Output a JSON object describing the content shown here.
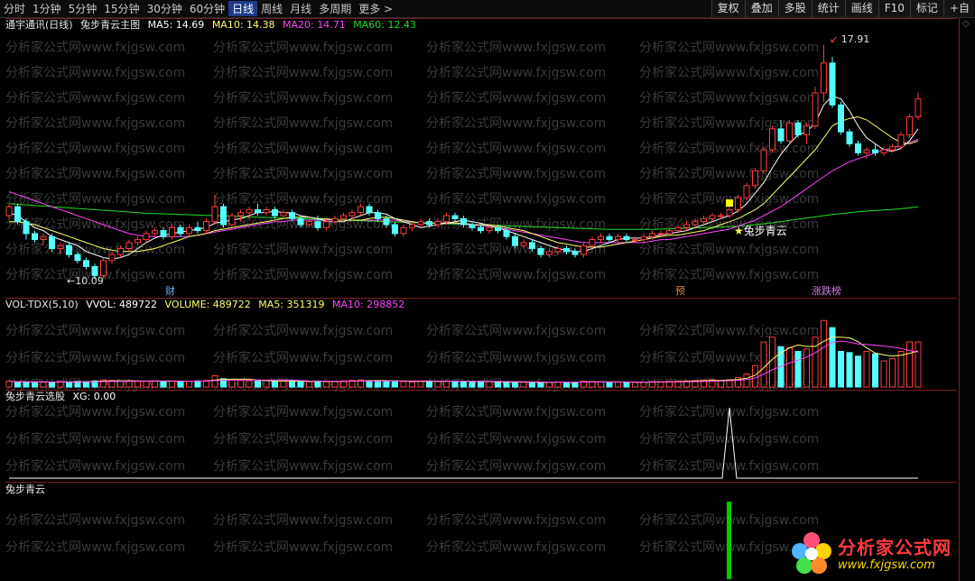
{
  "toolbar": {
    "timeframes": [
      "分时",
      "1分钟",
      "5分钟",
      "15分钟",
      "30分钟",
      "60分钟",
      "日线",
      "周线",
      "月线",
      "多周期",
      "更多 >"
    ],
    "active": "日线",
    "right_buttons": [
      "复权",
      "叠加",
      "多股",
      "统计",
      "画线",
      "F10",
      "标记",
      "+自"
    ]
  },
  "main_panel": {
    "stock": "通宇通讯(日线)",
    "indicator": "兔步青云主图",
    "ma5": "MA5: 14.69",
    "ma10": "MA10: 14.38",
    "ma20": "MA20: 14.71",
    "ma60": "MA60: 12.43",
    "high_label": "17.91",
    "low_label": "10.09",
    "signal_text": "兔步青云",
    "events": [
      "财",
      "预",
      "涨跌榜"
    ]
  },
  "vol_panel": {
    "name": "VOL-TDX(5,10)",
    "vvol": "VVOL: 489722",
    "volume": "VOLUME: 489722",
    "ma5": "MA5: 351319",
    "ma10": "MA10: 298852"
  },
  "xg_panel": {
    "name": "兔步青云选股",
    "xg": "XG: 0.00"
  },
  "signal_panel": {
    "name": "兔步青云"
  },
  "watermark": "分析家公式网www.fxjgsw.com",
  "logo": {
    "title": "分析家公式网",
    "url": "www.fxjgsw.com"
  },
  "colors": {
    "up": "#ff3b3b",
    "down": "#54ffff",
    "ma5": "#ffffff",
    "ma10": "#ffff66",
    "ma20": "#ff44ff",
    "ma60": "#22dd22",
    "signal": "#00cc00"
  },
  "chart_data": {
    "type": "candlestick",
    "price_range": [
      10.09,
      17.91
    ],
    "candles": [
      [
        12.2,
        12.6,
        12.1,
        12.5
      ],
      [
        12.5,
        12.6,
        11.9,
        12.0
      ],
      [
        12.0,
        12.1,
        11.4,
        11.6
      ],
      [
        11.6,
        11.7,
        11.3,
        11.4
      ],
      [
        11.4,
        11.6,
        11.2,
        11.5
      ],
      [
        11.5,
        11.6,
        11.0,
        11.1
      ],
      [
        11.1,
        11.3,
        10.9,
        11.2
      ],
      [
        11.2,
        11.3,
        10.8,
        10.9
      ],
      [
        10.9,
        11.0,
        10.6,
        10.7
      ],
      [
        10.7,
        10.8,
        10.4,
        10.5
      ],
      [
        10.5,
        10.6,
        10.09,
        10.2
      ],
      [
        10.2,
        10.8,
        10.1,
        10.7
      ],
      [
        10.7,
        11.0,
        10.6,
        10.9
      ],
      [
        10.9,
        11.2,
        10.8,
        11.1
      ],
      [
        11.1,
        11.4,
        11.0,
        11.3
      ],
      [
        11.3,
        11.5,
        11.2,
        11.4
      ],
      [
        11.4,
        11.7,
        11.3,
        11.6
      ],
      [
        11.6,
        11.8,
        11.5,
        11.7
      ],
      [
        11.7,
        11.8,
        11.4,
        11.5
      ],
      [
        11.5,
        11.9,
        11.4,
        11.8
      ],
      [
        11.8,
        11.9,
        11.5,
        11.6
      ],
      [
        11.6,
        11.9,
        11.5,
        11.8
      ],
      [
        11.8,
        12.0,
        11.6,
        11.7
      ],
      [
        11.7,
        12.1,
        11.6,
        12.0
      ],
      [
        12.0,
        12.9,
        11.9,
        12.5
      ],
      [
        12.5,
        12.6,
        11.8,
        11.9
      ],
      [
        11.9,
        12.3,
        11.8,
        12.2
      ],
      [
        12.2,
        12.4,
        12.0,
        12.3
      ],
      [
        12.3,
        12.5,
        12.1,
        12.4
      ],
      [
        12.4,
        12.6,
        12.2,
        12.3
      ],
      [
        12.3,
        12.5,
        12.2,
        12.4
      ],
      [
        12.4,
        12.5,
        12.1,
        12.2
      ],
      [
        12.2,
        12.4,
        12.1,
        12.3
      ],
      [
        12.3,
        12.4,
        12.0,
        12.1
      ],
      [
        12.1,
        12.2,
        11.8,
        11.9
      ],
      [
        11.9,
        12.1,
        11.8,
        12.0
      ],
      [
        12.0,
        12.2,
        11.7,
        11.8
      ],
      [
        11.8,
        12.1,
        11.7,
        12.0
      ],
      [
        12.0,
        12.2,
        11.9,
        12.1
      ],
      [
        12.1,
        12.3,
        12.0,
        12.2
      ],
      [
        12.2,
        12.4,
        12.1,
        12.3
      ],
      [
        12.3,
        12.6,
        12.2,
        12.5
      ],
      [
        12.5,
        12.6,
        12.2,
        12.3
      ],
      [
        12.3,
        12.4,
        12.0,
        12.1
      ],
      [
        12.1,
        12.2,
        11.8,
        11.9
      ],
      [
        11.9,
        12.0,
        11.5,
        11.6
      ],
      [
        11.6,
        11.9,
        11.5,
        11.8
      ],
      [
        11.8,
        12.0,
        11.7,
        11.9
      ],
      [
        11.9,
        12.1,
        11.8,
        12.0
      ],
      [
        12.0,
        12.1,
        11.8,
        11.9
      ],
      [
        11.9,
        12.1,
        11.8,
        12.0
      ],
      [
        12.0,
        12.3,
        11.9,
        12.2
      ],
      [
        12.2,
        12.3,
        12.0,
        12.1
      ],
      [
        12.1,
        12.2,
        11.8,
        11.9
      ],
      [
        11.9,
        12.0,
        11.7,
        11.8
      ],
      [
        11.8,
        11.9,
        11.6,
        11.7
      ],
      [
        11.7,
        11.9,
        11.6,
        11.8
      ],
      [
        11.8,
        11.9,
        11.6,
        11.7
      ],
      [
        11.7,
        11.8,
        11.4,
        11.5
      ],
      [
        11.5,
        11.6,
        11.1,
        11.2
      ],
      [
        11.2,
        11.4,
        11.1,
        11.3
      ],
      [
        11.3,
        11.4,
        11.0,
        11.1
      ],
      [
        11.1,
        11.2,
        10.8,
        10.9
      ],
      [
        10.9,
        11.1,
        10.8,
        11.0
      ],
      [
        11.0,
        11.2,
        10.9,
        11.1
      ],
      [
        11.1,
        11.2,
        10.9,
        11.0
      ],
      [
        11.0,
        11.1,
        10.8,
        10.9
      ],
      [
        10.9,
        11.3,
        10.8,
        11.2
      ],
      [
        11.2,
        11.5,
        11.1,
        11.4
      ],
      [
        11.4,
        11.6,
        11.3,
        11.5
      ],
      [
        11.5,
        11.6,
        11.3,
        11.4
      ],
      [
        11.4,
        11.6,
        11.3,
        11.5
      ],
      [
        11.5,
        11.6,
        11.3,
        11.4
      ],
      [
        11.4,
        11.5,
        11.3,
        11.4
      ],
      [
        11.4,
        11.6,
        11.3,
        11.5
      ],
      [
        11.5,
        11.7,
        11.4,
        11.6
      ],
      [
        11.6,
        11.7,
        11.5,
        11.6
      ],
      [
        11.6,
        11.8,
        11.5,
        11.7
      ],
      [
        11.7,
        11.9,
        11.6,
        11.8
      ],
      [
        11.8,
        12.0,
        11.7,
        11.9
      ],
      [
        11.9,
        12.1,
        11.8,
        12.0
      ],
      [
        12.0,
        12.2,
        11.9,
        12.1
      ],
      [
        12.1,
        12.3,
        12.0,
        12.2
      ],
      [
        12.2,
        12.3,
        12.1,
        12.2
      ],
      [
        12.2,
        12.5,
        12.1,
        12.4
      ],
      [
        12.4,
        12.9,
        12.3,
        12.8
      ],
      [
        12.8,
        13.3,
        12.7,
        13.2
      ],
      [
        13.2,
        13.8,
        13.1,
        13.7
      ],
      [
        13.7,
        14.5,
        13.6,
        14.4
      ],
      [
        14.4,
        15.2,
        14.3,
        15.1
      ],
      [
        15.1,
        15.4,
        14.6,
        14.7
      ],
      [
        14.7,
        15.4,
        14.6,
        15.3
      ],
      [
        15.3,
        15.4,
        14.8,
        14.9
      ],
      [
        14.9,
        15.3,
        14.6,
        15.2
      ],
      [
        15.2,
        16.5,
        15.1,
        16.3
      ],
      [
        16.3,
        17.91,
        16.0,
        17.3
      ],
      [
        17.3,
        17.5,
        15.8,
        15.9
      ],
      [
        15.9,
        16.0,
        14.9,
        15.0
      ],
      [
        15.0,
        15.1,
        14.5,
        14.6
      ],
      [
        14.6,
        14.7,
        14.2,
        14.3
      ],
      [
        14.3,
        14.5,
        14.1,
        14.4
      ],
      [
        14.4,
        14.6,
        14.2,
        14.3
      ],
      [
        14.3,
        14.5,
        14.2,
        14.4
      ],
      [
        14.4,
        14.6,
        14.3,
        14.5
      ],
      [
        14.5,
        15.0,
        14.4,
        14.9
      ],
      [
        14.9,
        15.6,
        14.8,
        15.5
      ],
      [
        15.5,
        16.3,
        15.4,
        16.1
      ]
    ],
    "volume": [
      50,
      40,
      45,
      38,
      42,
      40,
      44,
      43,
      48,
      46,
      52,
      60,
      55,
      50,
      48,
      47,
      49,
      52,
      48,
      50,
      46,
      48,
      52,
      55,
      95,
      70,
      60,
      55,
      52,
      50,
      54,
      48,
      50,
      52,
      46,
      45,
      50,
      44,
      47,
      52,
      56,
      60,
      54,
      50,
      48,
      52,
      46,
      44,
      48,
      50,
      47,
      52,
      50,
      48,
      44,
      42,
      46,
      44,
      40,
      42,
      40,
      42,
      38,
      40,
      44,
      40,
      38,
      50,
      46,
      44,
      40,
      42,
      40,
      38,
      42,
      46,
      44,
      48,
      50,
      52,
      55,
      58,
      60,
      56,
      62,
      80,
      110,
      180,
      380,
      420,
      340,
      330,
      300,
      320,
      420,
      560,
      500,
      300,
      290,
      260,
      300,
      280,
      220,
      240,
      300,
      380,
      380
    ],
    "ma5": [
      12.3,
      12.2,
      12.0,
      11.8,
      11.7,
      11.5,
      11.4,
      11.3,
      11.2,
      11.0,
      10.9,
      10.8,
      10.75,
      10.8,
      10.9,
      11.1,
      11.3,
      11.45,
      11.55,
      11.6,
      11.65,
      11.7,
      11.75,
      11.8,
      11.95,
      12.0,
      12.05,
      12.1,
      12.2,
      12.3,
      12.3,
      12.35,
      12.3,
      12.3,
      12.2,
      12.15,
      12.1,
      12.0,
      12.0,
      12.0,
      12.1,
      12.2,
      12.3,
      12.3,
      12.25,
      12.1,
      12.0,
      11.9,
      11.8,
      11.85,
      11.9,
      11.95,
      12.0,
      12.05,
      12.0,
      11.95,
      11.85,
      11.8,
      11.7,
      11.6,
      11.5,
      11.4,
      11.3,
      11.2,
      11.1,
      11.05,
      11.0,
      11.0,
      11.1,
      11.2,
      11.3,
      11.4,
      11.45,
      11.45,
      11.45,
      11.5,
      11.55,
      11.6,
      11.65,
      11.7,
      11.8,
      11.9,
      12.0,
      12.1,
      12.2,
      12.35,
      12.6,
      12.95,
      13.3,
      13.8,
      14.25,
      14.6,
      14.9,
      15.0,
      15.3,
      15.9,
      16.2,
      16.1,
      15.7,
      15.2,
      14.8,
      14.6,
      14.4,
      14.35,
      14.45,
      14.7,
      15.1
    ],
    "ma10": [
      12.0,
      12.0,
      11.95,
      11.9,
      11.8,
      11.7,
      11.6,
      11.5,
      11.4,
      11.3,
      11.2,
      11.1,
      11.05,
      11.0,
      11.0,
      11.0,
      11.05,
      11.1,
      11.2,
      11.3,
      11.4,
      11.5,
      11.55,
      11.6,
      11.7,
      11.75,
      11.8,
      11.85,
      11.9,
      11.95,
      12.0,
      12.05,
      12.1,
      12.15,
      12.15,
      12.15,
      12.1,
      12.1,
      12.05,
      12.05,
      12.05,
      12.05,
      12.1,
      12.15,
      12.15,
      12.1,
      12.05,
      12.0,
      11.95,
      11.95,
      11.95,
      11.95,
      11.95,
      11.95,
      11.9,
      11.9,
      11.9,
      11.85,
      11.8,
      11.75,
      11.7,
      11.6,
      11.5,
      11.4,
      11.3,
      11.25,
      11.2,
      11.15,
      11.15,
      11.15,
      11.2,
      11.25,
      11.3,
      11.35,
      11.4,
      11.45,
      11.5,
      11.55,
      11.55,
      11.6,
      11.65,
      11.7,
      11.8,
      11.9,
      12.0,
      12.1,
      12.25,
      12.4,
      12.6,
      12.9,
      13.2,
      13.5,
      13.8,
      14.1,
      14.4,
      14.8,
      15.2,
      15.35,
      15.45,
      15.5,
      15.4,
      15.2,
      15.0,
      14.8,
      14.65,
      14.6,
      14.7
    ],
    "ma20": [
      13.0,
      12.9,
      12.8,
      12.7,
      12.6,
      12.5,
      12.4,
      12.3,
      12.2,
      12.1,
      12.0,
      11.9,
      11.8,
      11.7,
      11.6,
      11.55,
      11.5,
      11.5,
      11.5,
      11.5,
      11.5,
      11.5,
      11.55,
      11.6,
      11.65,
      11.7,
      11.75,
      11.8,
      11.85,
      11.9,
      11.95,
      12.0,
      12.0,
      12.05,
      12.05,
      12.05,
      12.05,
      12.05,
      12.05,
      12.05,
      12.05,
      12.05,
      12.05,
      12.05,
      12.05,
      12.05,
      12.0,
      12.0,
      11.95,
      11.95,
      11.95,
      11.95,
      11.95,
      11.9,
      11.9,
      11.85,
      11.85,
      11.8,
      11.75,
      11.7,
      11.65,
      11.6,
      11.55,
      11.5,
      11.45,
      11.4,
      11.35,
      11.3,
      11.3,
      11.3,
      11.3,
      11.3,
      11.3,
      11.3,
      11.3,
      11.35,
      11.4,
      11.4,
      11.45,
      11.5,
      11.55,
      11.6,
      11.65,
      11.7,
      11.75,
      11.85,
      11.95,
      12.05,
      12.2,
      12.35,
      12.5,
      12.7,
      12.9,
      13.1,
      13.3,
      13.5,
      13.7,
      13.85,
      14.0,
      14.1,
      14.2,
      14.3,
      14.4,
      14.45,
      14.55,
      14.65,
      14.75
    ],
    "ma60": [
      12.6,
      12.58,
      12.56,
      12.54,
      12.52,
      12.5,
      12.48,
      12.46,
      12.44,
      12.42,
      12.4,
      12.38,
      12.36,
      12.34,
      12.32,
      12.3,
      12.28,
      12.27,
      12.26,
      12.25,
      12.24,
      12.23,
      12.22,
      12.21,
      12.2,
      12.19,
      12.18,
      12.17,
      12.16,
      12.15,
      12.14,
      12.13,
      12.12,
      12.11,
      12.1,
      12.09,
      12.08,
      12.07,
      12.06,
      12.05,
      12.04,
      12.03,
      12.02,
      12.01,
      12.0,
      11.99,
      11.98,
      11.97,
      11.96,
      11.95,
      11.94,
      11.93,
      11.92,
      11.91,
      11.9,
      11.89,
      11.88,
      11.87,
      11.86,
      11.85,
      11.84,
      11.83,
      11.82,
      11.81,
      11.8,
      11.79,
      11.78,
      11.77,
      11.76,
      11.75,
      11.74,
      11.74,
      11.74,
      11.74,
      11.74,
      11.74,
      11.75,
      11.76,
      11.77,
      11.78,
      11.79,
      11.8,
      11.81,
      11.82,
      11.83,
      11.85,
      11.87,
      11.9,
      11.93,
      11.96,
      12.0,
      12.04,
      12.08,
      12.12,
      12.16,
      12.2,
      12.24,
      12.27,
      12.3,
      12.33,
      12.35,
      12.37,
      12.39,
      12.41,
      12.43,
      12.46,
      12.5
    ],
    "signal_index": 84
  }
}
